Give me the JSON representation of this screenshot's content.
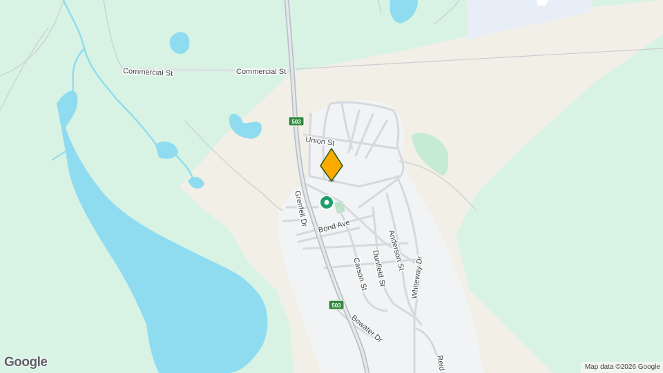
{
  "map": {
    "colors": {
      "land_green": "#d8f3e4",
      "town_beige": "#f2efe6",
      "urban": "#f1f3f4",
      "water": "#8fdcf0",
      "park": "#c5ecd3",
      "road": "#dadce0",
      "highway": "#c6cdd3",
      "shield": "#2f8a3e",
      "marker_orange": "#fbab00",
      "marker_green": "#1e9e6a",
      "industrial": "#e8eef8"
    },
    "street_labels": {
      "commercial_st_1": "Commercial St",
      "commercial_st_2": "Commercial St",
      "union_st": "Union St",
      "grenfell_dr": "Grenfell Dr",
      "bond_ave": "Bond Ave",
      "anderson_st": "Anderson St",
      "dunfield_st": "Dunfield St",
      "carson_st": "Carson St",
      "whiteway_dr": "Whiteway Dr",
      "bowater_dr": "Bowater Dr",
      "reid": "Reid"
    },
    "route_shields": [
      "503",
      "503"
    ],
    "markers": {
      "location_pin": "orange-diamond-location-pin",
      "place_marker": "green-place-marker"
    },
    "logo_text": "Google",
    "attribution": "Map data ©2026 Google"
  }
}
